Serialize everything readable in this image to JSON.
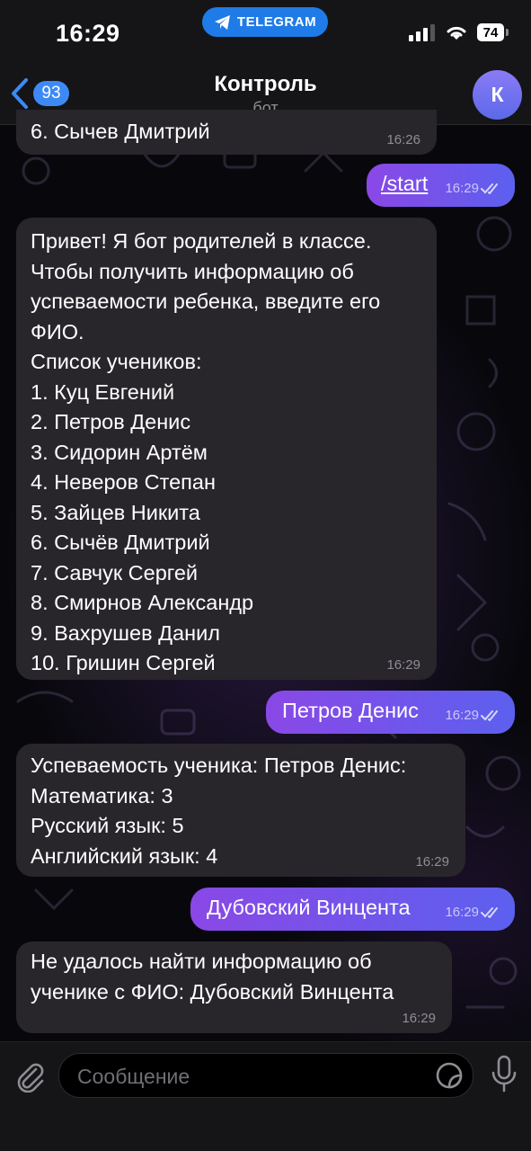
{
  "status": {
    "time": "16:29",
    "app_pill": "TELEGRAM",
    "battery": "74"
  },
  "header": {
    "back_count": "93",
    "title": "Контроль",
    "subtitle": "бот",
    "avatar_letter": "К"
  },
  "messages": [
    {
      "dir": "in",
      "text": "6. Сычев Дмитрий",
      "time": "16:26"
    },
    {
      "dir": "out",
      "text": "/start",
      "time": "16:29"
    },
    {
      "dir": "in",
      "text": "Привет! Я бот родителей в классе.\nЧтобы получить информацию об\nуспеваемости ребенка, введите его\nФИО.\nСписок учеников:\n1. Куц Евгений\n2. Петров Денис\n3. Сидорин Артём\n4. Неверов Степан\n5. Зайцев Никита\n6. Сычёв Дмитрий\n7. Савчук Сергей\n8. Смирнов Александр\n9. Вахрушев Данил\n10. Гришин Сергей",
      "time": "16:29"
    },
    {
      "dir": "out",
      "text": "Петров Денис",
      "time": "16:29"
    },
    {
      "dir": "in",
      "text": "Успеваемость ученика: Петров Денис:\nМатематика: 3\nРусский язык: 5\nАнглийский язык: 4",
      "time": "16:29"
    },
    {
      "dir": "out",
      "text": "Дубовский Винцента",
      "time": "16:29"
    },
    {
      "dir": "in",
      "text": "Не удалось найти информацию об\nученике с ФИО: Дубовский Винцента",
      "time": "16:29"
    }
  ],
  "composer": {
    "placeholder": "Сообщение"
  },
  "colors": {
    "accent": "#3d8af7",
    "outgoing_start": "#8a48e6",
    "outgoing_end": "#5c60ee",
    "incoming": "#28262b"
  },
  "icons": {
    "back": "chevron-left-icon",
    "attach": "paperclip-icon",
    "sticker": "sticker-icon",
    "mic": "microphone-icon",
    "read": "double-check-icon"
  }
}
